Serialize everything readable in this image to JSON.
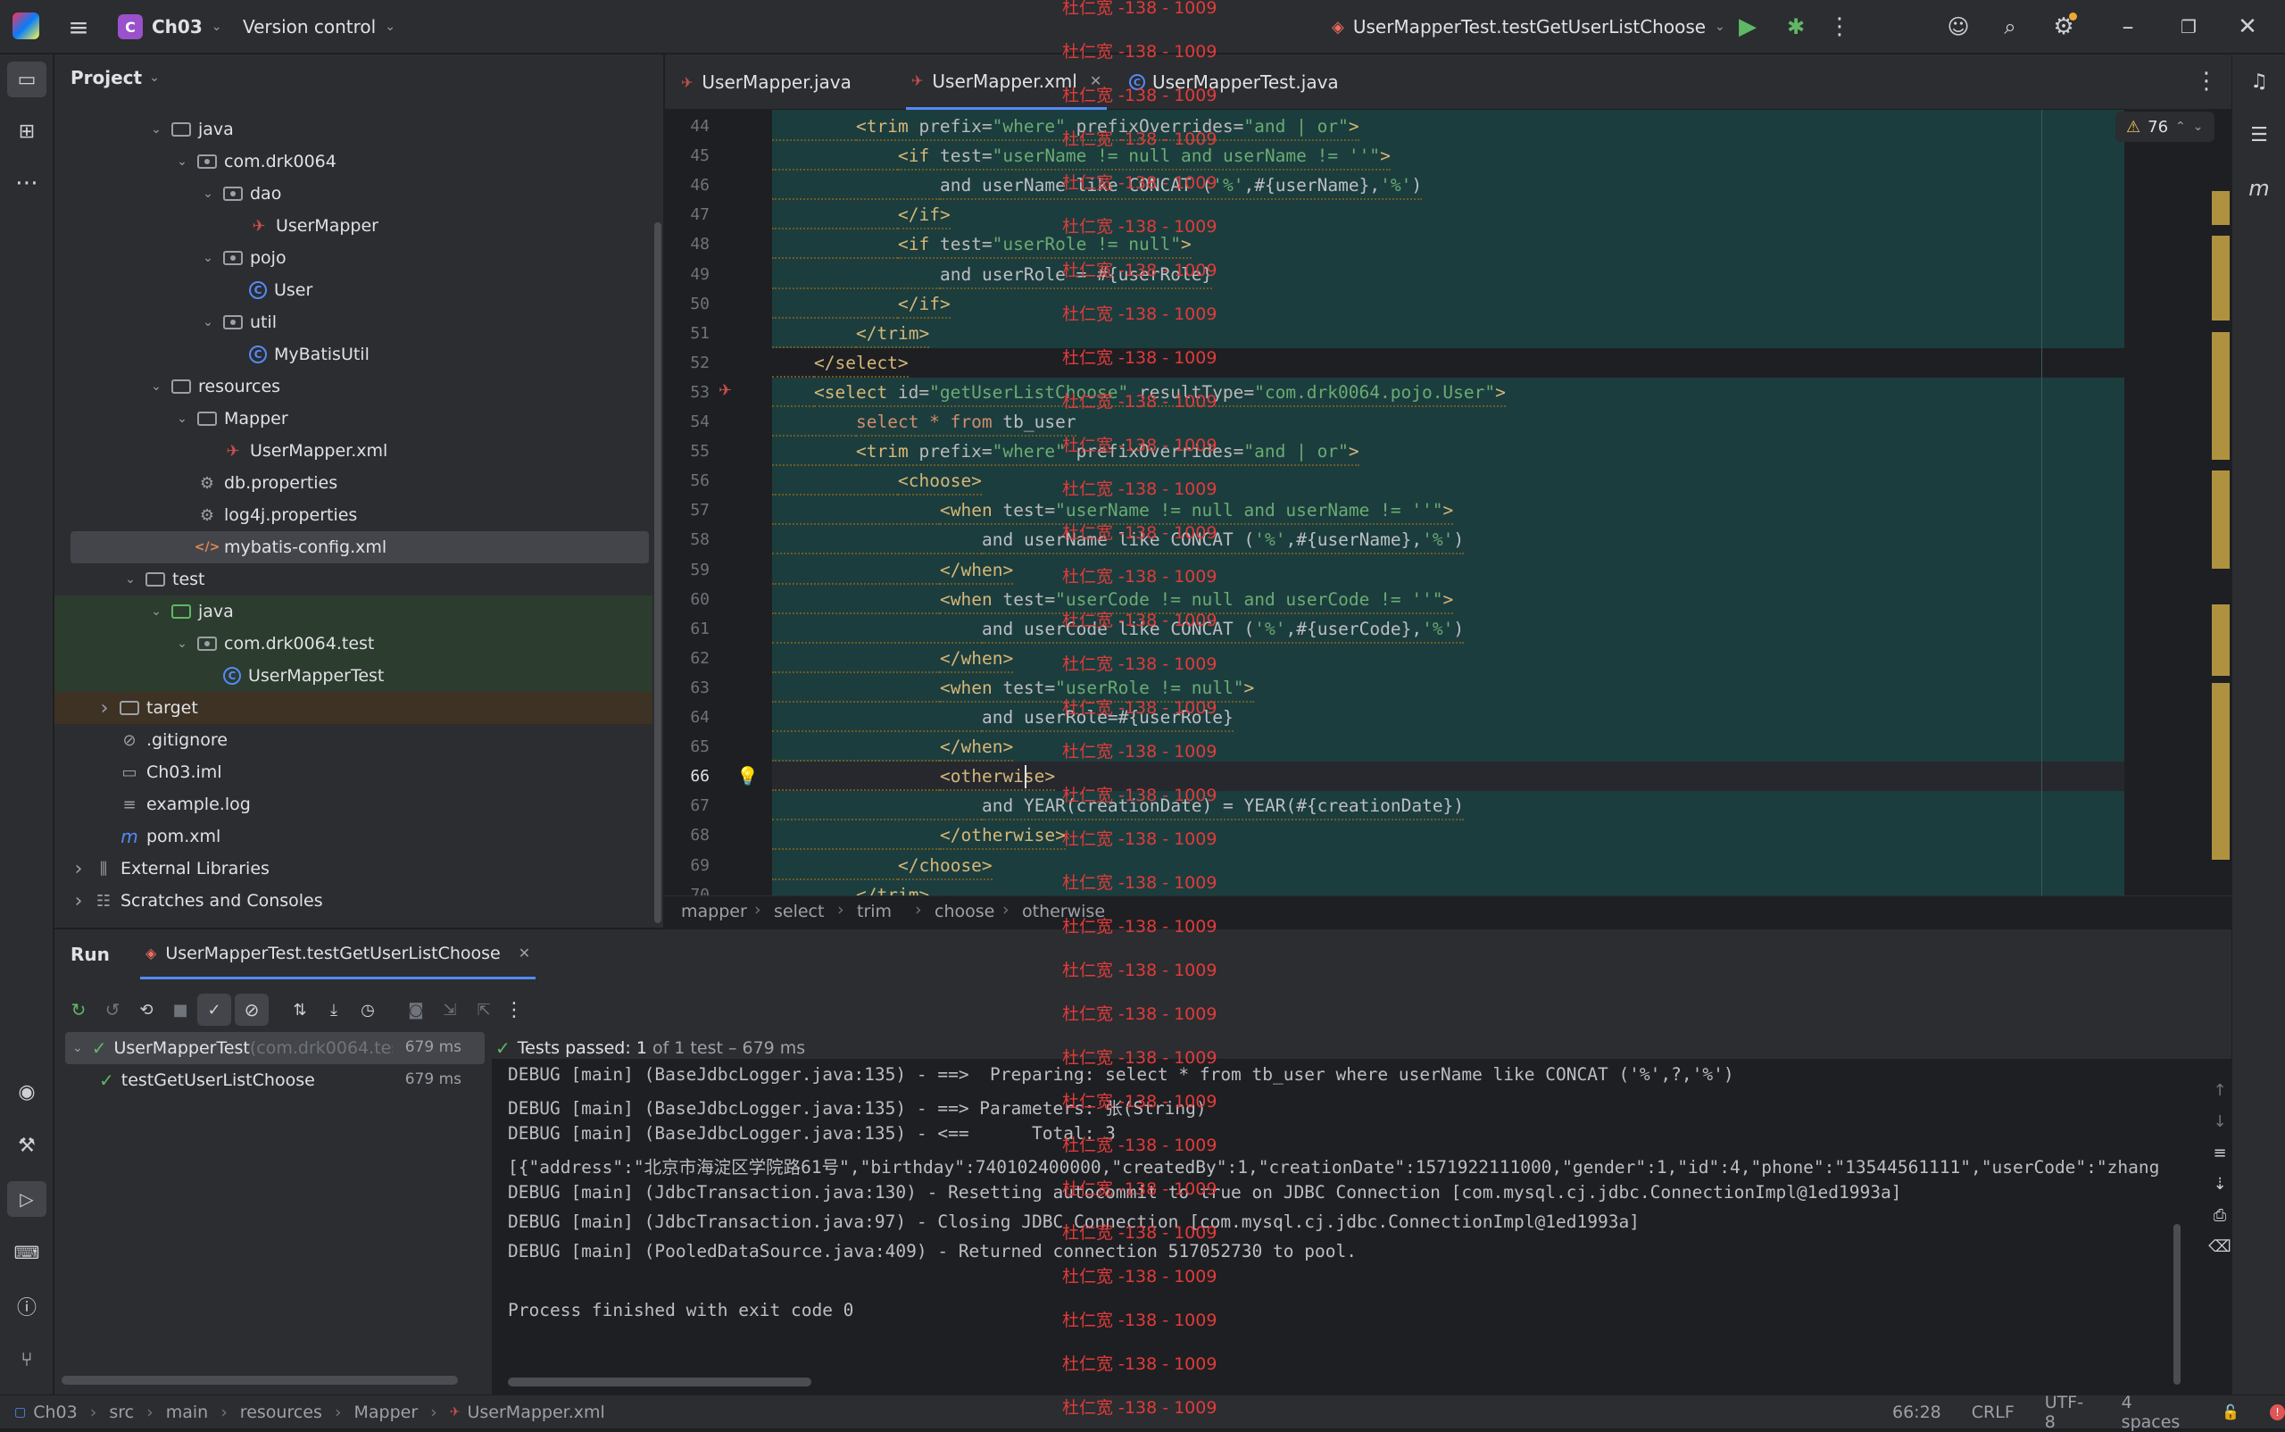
{
  "titlebar": {
    "project_badge": "C",
    "project": "Ch03",
    "vcs": "Version control",
    "run_config": "UserMapperTest.testGetUserListChoose"
  },
  "project_panel": {
    "title": "Project",
    "items": [
      {
        "label": "java",
        "depth": 3,
        "toggle": "v",
        "icon": "folder-icon"
      },
      {
        "label": "com.drk0064",
        "depth": 4,
        "toggle": "v",
        "icon": "package-icon"
      },
      {
        "label": "dao",
        "depth": 5,
        "toggle": "v",
        "icon": "package-icon"
      },
      {
        "label": "UserMapper",
        "depth": 6,
        "toggle": "",
        "icon": "mybatis-icon"
      },
      {
        "label": "pojo",
        "depth": 5,
        "toggle": "v",
        "icon": "package-icon"
      },
      {
        "label": "User",
        "depth": 6,
        "toggle": "",
        "icon": "class-icon"
      },
      {
        "label": "util",
        "depth": 5,
        "toggle": "v",
        "icon": "package-icon"
      },
      {
        "label": "MyBatisUtil",
        "depth": 6,
        "toggle": "",
        "icon": "class-icon"
      },
      {
        "label": "resources",
        "depth": 3,
        "toggle": "v",
        "icon": "folder-icon"
      },
      {
        "label": "Mapper",
        "depth": 4,
        "toggle": "v",
        "icon": "folder-icon"
      },
      {
        "label": "UserMapper.xml",
        "depth": 5,
        "toggle": "",
        "icon": "mybatis-icon"
      },
      {
        "label": "db.properties",
        "depth": 4,
        "toggle": "",
        "icon": "gear-icon"
      },
      {
        "label": "log4j.properties",
        "depth": 4,
        "toggle": "",
        "icon": "gear-icon"
      },
      {
        "label": "mybatis-config.xml",
        "depth": 4,
        "toggle": "",
        "icon": "xml-icon",
        "selected": true
      },
      {
        "label": "test",
        "depth": 2,
        "toggle": "v",
        "icon": "folder-icon"
      },
      {
        "label": "java",
        "depth": 3,
        "toggle": "v",
        "icon": "folder-icon",
        "testbg": true
      },
      {
        "label": "com.drk0064.test",
        "depth": 4,
        "toggle": "v",
        "icon": "package-icon",
        "testbg": true
      },
      {
        "label": "UserMapperTest",
        "depth": 5,
        "toggle": "",
        "icon": "class-icon",
        "testbg": true
      },
      {
        "label": "target",
        "depth": 1,
        "toggle": ">",
        "icon": "folder-icon",
        "targetbg": true
      },
      {
        "label": ".gitignore",
        "depth": 1,
        "toggle": "",
        "icon": "ignore-icon"
      },
      {
        "label": "Ch03.iml",
        "depth": 1,
        "toggle": "",
        "icon": "file-icon"
      },
      {
        "label": "example.log",
        "depth": 1,
        "toggle": "",
        "icon": "log-icon"
      },
      {
        "label": "pom.xml",
        "depth": 1,
        "toggle": "",
        "icon": "maven-icon"
      },
      {
        "label": "External Libraries",
        "depth": 0,
        "toggle": ">",
        "icon": "library-icon"
      },
      {
        "label": "Scratches and Consoles",
        "depth": 0,
        "toggle": ">",
        "icon": "scratch-icon"
      }
    ]
  },
  "editor": {
    "tabs": [
      {
        "label": "UserMapper.java"
      },
      {
        "label": "UserMapper.xml",
        "active": true
      },
      {
        "label": "UserMapperTest.java"
      }
    ],
    "warnings": "76",
    "lines": [
      {
        "n": "44",
        "indent": 2,
        "parts": [
          [
            "tagc",
            "<trim "
          ],
          [
            "at",
            "prefix="
          ],
          [
            "av",
            "\"where\" "
          ],
          [
            "at",
            "prefixOverrides="
          ],
          [
            "av",
            "\"and | or\""
          ],
          [
            "tagc",
            ">"
          ]
        ]
      },
      {
        "n": "45",
        "indent": 3,
        "parts": [
          [
            "tagc",
            "<if "
          ],
          [
            "at",
            "test="
          ],
          [
            "av",
            "\"userName != null and userName != ''\""
          ],
          [
            "tagc",
            ">"
          ]
        ]
      },
      {
        "n": "46",
        "indent": 4,
        "parts": [
          [
            "tx",
            "and userName like CONCAT ("
          ],
          [
            "av",
            "'%'"
          ],
          [
            "tx",
            ",#{userName},"
          ],
          [
            "av",
            "'%'"
          ],
          [
            "tx",
            ")"
          ]
        ]
      },
      {
        "n": "47",
        "indent": 3,
        "parts": [
          [
            "tagc",
            "</if>"
          ]
        ]
      },
      {
        "n": "48",
        "indent": 3,
        "parts": [
          [
            "tagc",
            "<if "
          ],
          [
            "at",
            "test="
          ],
          [
            "av",
            "\"userRole != null\""
          ],
          [
            "tagc",
            ">"
          ]
        ]
      },
      {
        "n": "49",
        "indent": 4,
        "parts": [
          [
            "tx",
            "and userRole = #{userRole}"
          ]
        ]
      },
      {
        "n": "50",
        "indent": 3,
        "parts": [
          [
            "tagc",
            "</if>"
          ]
        ]
      },
      {
        "n": "51",
        "indent": 2,
        "parts": [
          [
            "tagc",
            "</trim>"
          ]
        ]
      },
      {
        "n": "52",
        "indent": 1,
        "parts": [
          [
            "tagc",
            "</select>"
          ]
        ]
      },
      {
        "n": "53",
        "indent": 1,
        "parts": [
          [
            "tagc",
            "<select "
          ],
          [
            "at",
            "id="
          ],
          [
            "av",
            "\"getUserListChoose\" "
          ],
          [
            "at",
            "resultType="
          ],
          [
            "av",
            "\"com.drk0064.pojo.User\""
          ],
          [
            "tagc",
            ">"
          ]
        ]
      },
      {
        "n": "54",
        "indent": 2,
        "parts": [
          [
            "kw",
            "select * from "
          ],
          [
            "tx",
            "tb_user"
          ]
        ]
      },
      {
        "n": "55",
        "indent": 2,
        "parts": [
          [
            "tagc",
            "<trim "
          ],
          [
            "at",
            "prefix="
          ],
          [
            "av",
            "\"where\" "
          ],
          [
            "at",
            "prefixOverrides="
          ],
          [
            "av",
            "\"and | or\""
          ],
          [
            "tagc",
            ">"
          ]
        ]
      },
      {
        "n": "56",
        "indent": 3,
        "parts": [
          [
            "tagc",
            "<choose>"
          ]
        ]
      },
      {
        "n": "57",
        "indent": 4,
        "parts": [
          [
            "tagc",
            "<when "
          ],
          [
            "at",
            "test="
          ],
          [
            "av",
            "\"userName != null and userName != ''\""
          ],
          [
            "tagc",
            ">"
          ]
        ]
      },
      {
        "n": "58",
        "indent": 5,
        "parts": [
          [
            "tx",
            "and userName like CONCAT ("
          ],
          [
            "av",
            "'%'"
          ],
          [
            "tx",
            ",#{userName},"
          ],
          [
            "av",
            "'%'"
          ],
          [
            "tx",
            ")"
          ]
        ]
      },
      {
        "n": "59",
        "indent": 4,
        "parts": [
          [
            "tagc",
            "</when>"
          ]
        ]
      },
      {
        "n": "60",
        "indent": 4,
        "parts": [
          [
            "tagc",
            "<when "
          ],
          [
            "at",
            "test="
          ],
          [
            "av",
            "\"userCode != null and userCode != ''\""
          ],
          [
            "tagc",
            ">"
          ]
        ]
      },
      {
        "n": "61",
        "indent": 5,
        "parts": [
          [
            "tx",
            "and userCode like CONCAT ("
          ],
          [
            "av",
            "'%'"
          ],
          [
            "tx",
            ",#{userCode},"
          ],
          [
            "av",
            "'%'"
          ],
          [
            "tx",
            ")"
          ]
        ]
      },
      {
        "n": "62",
        "indent": 4,
        "parts": [
          [
            "tagc",
            "</when>"
          ]
        ]
      },
      {
        "n": "63",
        "indent": 4,
        "parts": [
          [
            "tagc",
            "<when "
          ],
          [
            "at",
            "test="
          ],
          [
            "av",
            "\"userRole != null\""
          ],
          [
            "tagc",
            ">"
          ]
        ]
      },
      {
        "n": "64",
        "indent": 5,
        "parts": [
          [
            "tx",
            "and userRole=#{userRole}"
          ]
        ]
      },
      {
        "n": "65",
        "indent": 4,
        "parts": [
          [
            "tagc",
            "</when>"
          ]
        ]
      },
      {
        "n": "66",
        "indent": 4,
        "parts": [
          [
            "tagc",
            "<otherwise>"
          ]
        ],
        "current": true
      },
      {
        "n": "67",
        "indent": 5,
        "parts": [
          [
            "tx",
            "and YEAR(creationDate) = YEAR(#{creationDate})"
          ]
        ]
      },
      {
        "n": "68",
        "indent": 4,
        "parts": [
          [
            "tagc",
            "</otherwise>"
          ]
        ]
      },
      {
        "n": "69",
        "indent": 3,
        "parts": [
          [
            "tagc",
            "</choose>"
          ]
        ]
      },
      {
        "n": "70",
        "indent": 2,
        "parts": [
          [
            "tagc",
            "</trim>"
          ]
        ]
      }
    ],
    "breadcrumb": [
      "mapper",
      "select",
      "trim",
      "choose",
      "otherwise"
    ]
  },
  "run": {
    "title": "Run",
    "tab": "UserMapperTest.testGetUserListChoose",
    "status_prefix": "Tests passed: ",
    "status_count": "1",
    "status_detail": " of 1 test – 679 ms",
    "tree": [
      {
        "label": "UserMapperTest",
        "suffix": " (com.drk0064.tes",
        "time": "679 ms"
      },
      {
        "label": "testGetUserListChoose",
        "suffix": "",
        "time": "679 ms"
      }
    ],
    "console": [
      "DEBUG [main] (BaseJdbcLogger.java:135) - ==>  Preparing: select * from tb_user where userName like CONCAT ('%',?,'%')",
      "DEBUG [main] (BaseJdbcLogger.java:135) - ==> Parameters: 张(String)",
      "DEBUG [main] (BaseJdbcLogger.java:135) - <==      Total: 3",
      "[{\"address\":\"北京市海淀区学院路61号\",\"birthday\":740102400000,\"createdBy\":1,\"creationDate\":1571922111000,\"gender\":1,\"id\":4,\"phone\":\"13544561111\",\"userCode\":\"zhang",
      "DEBUG [main] (JdbcTransaction.java:130) - Resetting autocommit to true on JDBC Connection [com.mysql.cj.jdbc.ConnectionImpl@1ed1993a]",
      "DEBUG [main] (JdbcTransaction.java:97) - Closing JDBC Connection [com.mysql.cj.jdbc.ConnectionImpl@1ed1993a]",
      "DEBUG [main] (PooledDataSource.java:409) - Returned connection 517052730 to pool.",
      "",
      "Process finished with exit code 0"
    ]
  },
  "watermark": "杜仁宽 -138 - 1009",
  "statusbar": {
    "path": [
      "Ch03",
      "src",
      "main",
      "resources",
      "Mapper",
      "UserMapper.xml"
    ],
    "position": "66:28",
    "line_sep": "CRLF",
    "encoding": "UTF-8",
    "indent": "4 spaces"
  },
  "colors": {
    "accent": "#548af7",
    "pass": "#5fb865",
    "xml_tag": "#d5b778",
    "attr_value": "#6aab73",
    "warning": "#c9a745"
  }
}
